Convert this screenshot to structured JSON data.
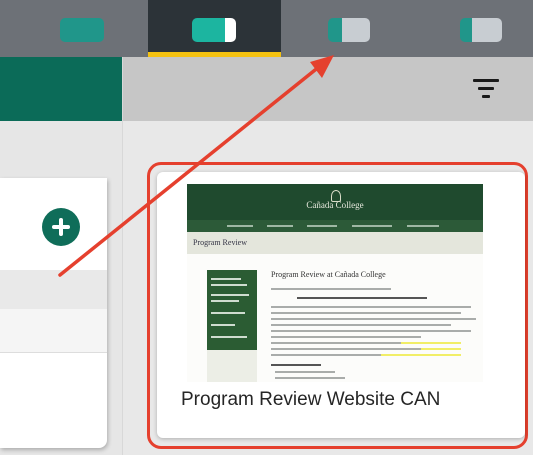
{
  "toolbar": {
    "layouts": [
      {
        "icon": "single-pane-layout-icon",
        "active": false
      },
      {
        "icon": "pane-with-sidebar-layout-icon",
        "active": true
      },
      {
        "icon": "split-pane-layout-icon",
        "active": false
      },
      {
        "icon": "narrow-left-pane-layout-icon",
        "active": false
      }
    ],
    "accent_color": "#f5c211"
  },
  "left_panel": {
    "header_color": "#0b6b58",
    "add_icon": "plus-circle-icon"
  },
  "right_panel": {
    "filter_icon": "filter-icon",
    "card": {
      "title": "Program Review Website CAN",
      "thumbnail": {
        "site_name": "Cañada College",
        "page_heading": "Program Review",
        "content_title": "Program Review at Cañada College"
      }
    }
  },
  "annotation": {
    "arrow_color": "#e5402e",
    "highlight_color": "#e5402e"
  }
}
